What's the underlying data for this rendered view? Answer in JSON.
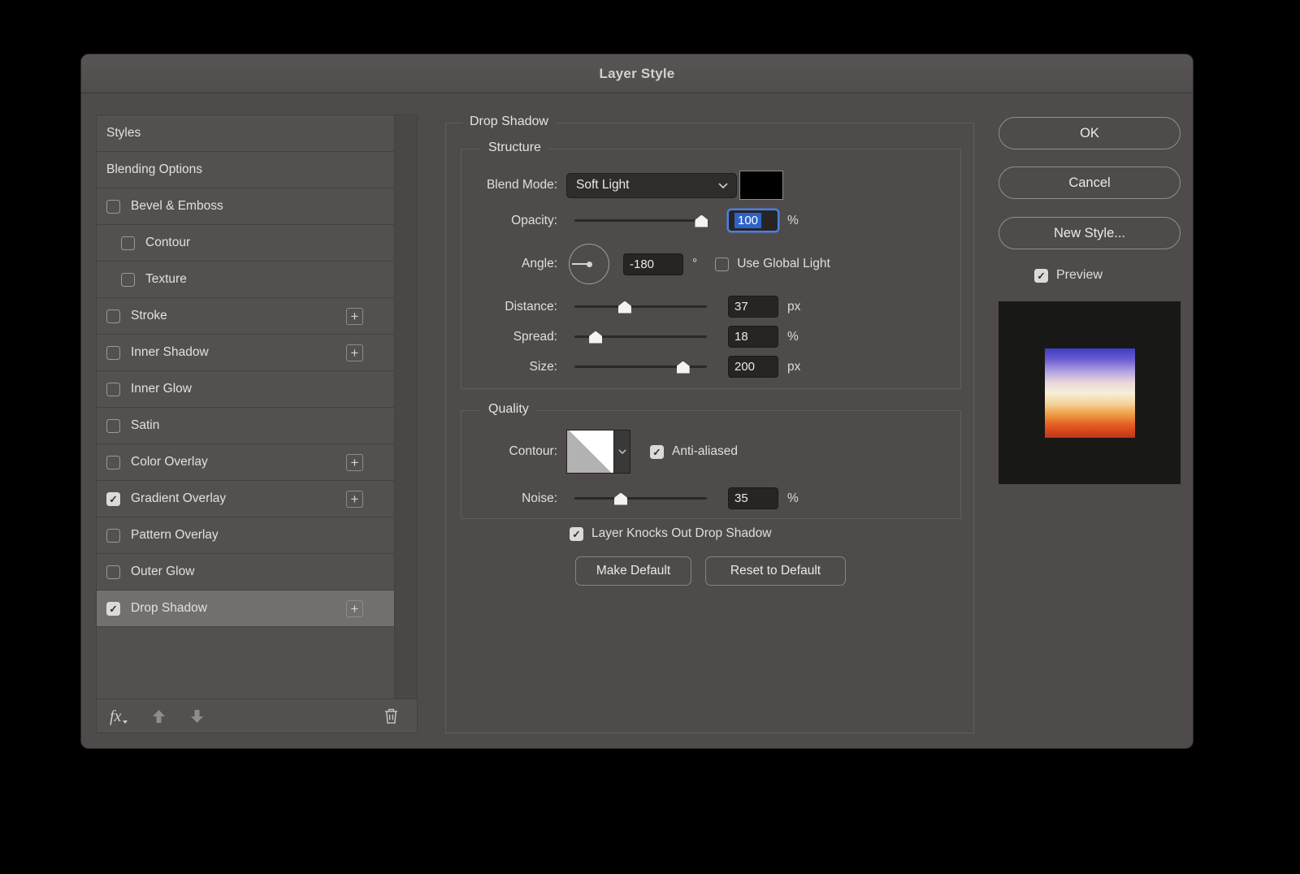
{
  "window": {
    "title": "Layer Style"
  },
  "colors": {
    "dialog_bg": "#4e4b4a",
    "selection_blue": "#2e62c9",
    "focus_ring_blue": "#4d7fe3",
    "shadow_swatch": "#000000"
  },
  "icons": {
    "plus": "+",
    "checkmark": "✓",
    "fx_menu_caret": "▾"
  },
  "sidebar": {
    "items": [
      {
        "label": "Styles"
      },
      {
        "label": "Blending Options"
      },
      {
        "label": "Bevel & Emboss",
        "check": ""
      },
      {
        "label": "Contour",
        "check": "",
        "indent": true
      },
      {
        "label": "Texture",
        "check": "",
        "indent": true
      },
      {
        "label": "Stroke",
        "check": "",
        "plus": true
      },
      {
        "label": "Inner Shadow",
        "check": "",
        "plus": true
      },
      {
        "label": "Inner Glow",
        "check": ""
      },
      {
        "label": "Satin",
        "check": ""
      },
      {
        "label": "Color Overlay",
        "check": "",
        "plus": true
      },
      {
        "label": "Gradient Overlay",
        "check": "✓",
        "plus": true
      },
      {
        "label": "Pattern Overlay",
        "check": ""
      },
      {
        "label": "Outer Glow",
        "check": ""
      },
      {
        "label": "Drop Shadow",
        "check": "✓",
        "plus": true,
        "selected": true
      }
    ],
    "footer": {
      "fx_label": "fx"
    }
  },
  "main": {
    "panel_title": "Drop Shadow",
    "structure": {
      "legend": "Structure",
      "blend_mode": {
        "label": "Blend Mode:",
        "value": "Soft Light",
        "swatch_color": "#000000",
        "swatch_style": "background:#000000"
      },
      "opacity": {
        "label": "Opacity:",
        "value": "100",
        "unit": "%",
        "percent": 96,
        "focused": true
      },
      "angle": {
        "label": "Angle:",
        "value": "-180",
        "unit": "°",
        "use_global_light": {
          "label": "Use Global Light",
          "check": ""
        }
      },
      "distance": {
        "label": "Distance:",
        "value": "37",
        "unit": "px",
        "percent": 38
      },
      "spread": {
        "label": "Spread:",
        "value": "18",
        "unit": "%",
        "percent": 16
      },
      "size": {
        "label": "Size:",
        "value": "200",
        "unit": "px",
        "percent": 82
      }
    },
    "quality": {
      "legend": "Quality",
      "contour": {
        "label": "Contour:",
        "anti_aliased": {
          "label": "Anti-aliased",
          "check": "✓"
        }
      },
      "noise": {
        "label": "Noise:",
        "value": "35",
        "unit": "%",
        "percent": 35
      }
    },
    "knockout": {
      "label": "Layer Knocks Out Drop Shadow",
      "check": "✓"
    },
    "buttons": {
      "make_default": "Make Default",
      "reset_default": "Reset to Default"
    }
  },
  "actions": {
    "ok": "OK",
    "cancel": "Cancel",
    "new_style": "New Style...",
    "preview": {
      "label": "Preview",
      "check": "✓"
    }
  },
  "preview_panel": {
    "surround_color": "#181817",
    "gradient_colors": [
      "#3e3ec4",
      "#6a5ad0",
      "#b3a4e0",
      "#e8d6da",
      "#f7efd8",
      "#f4d398",
      "#ef9c42",
      "#e35c20",
      "#c2331a"
    ],
    "gradient_css": "background:linear-gradient(180deg,#3e3ec4 0%,#6a5ad0 12%,#b3a4e0 26%,#e8d6da 38%,#f7efd8 50%,#f4d398 62%,#ef9c42 74%,#e35c20 86%,#c2331a 100%)"
  }
}
